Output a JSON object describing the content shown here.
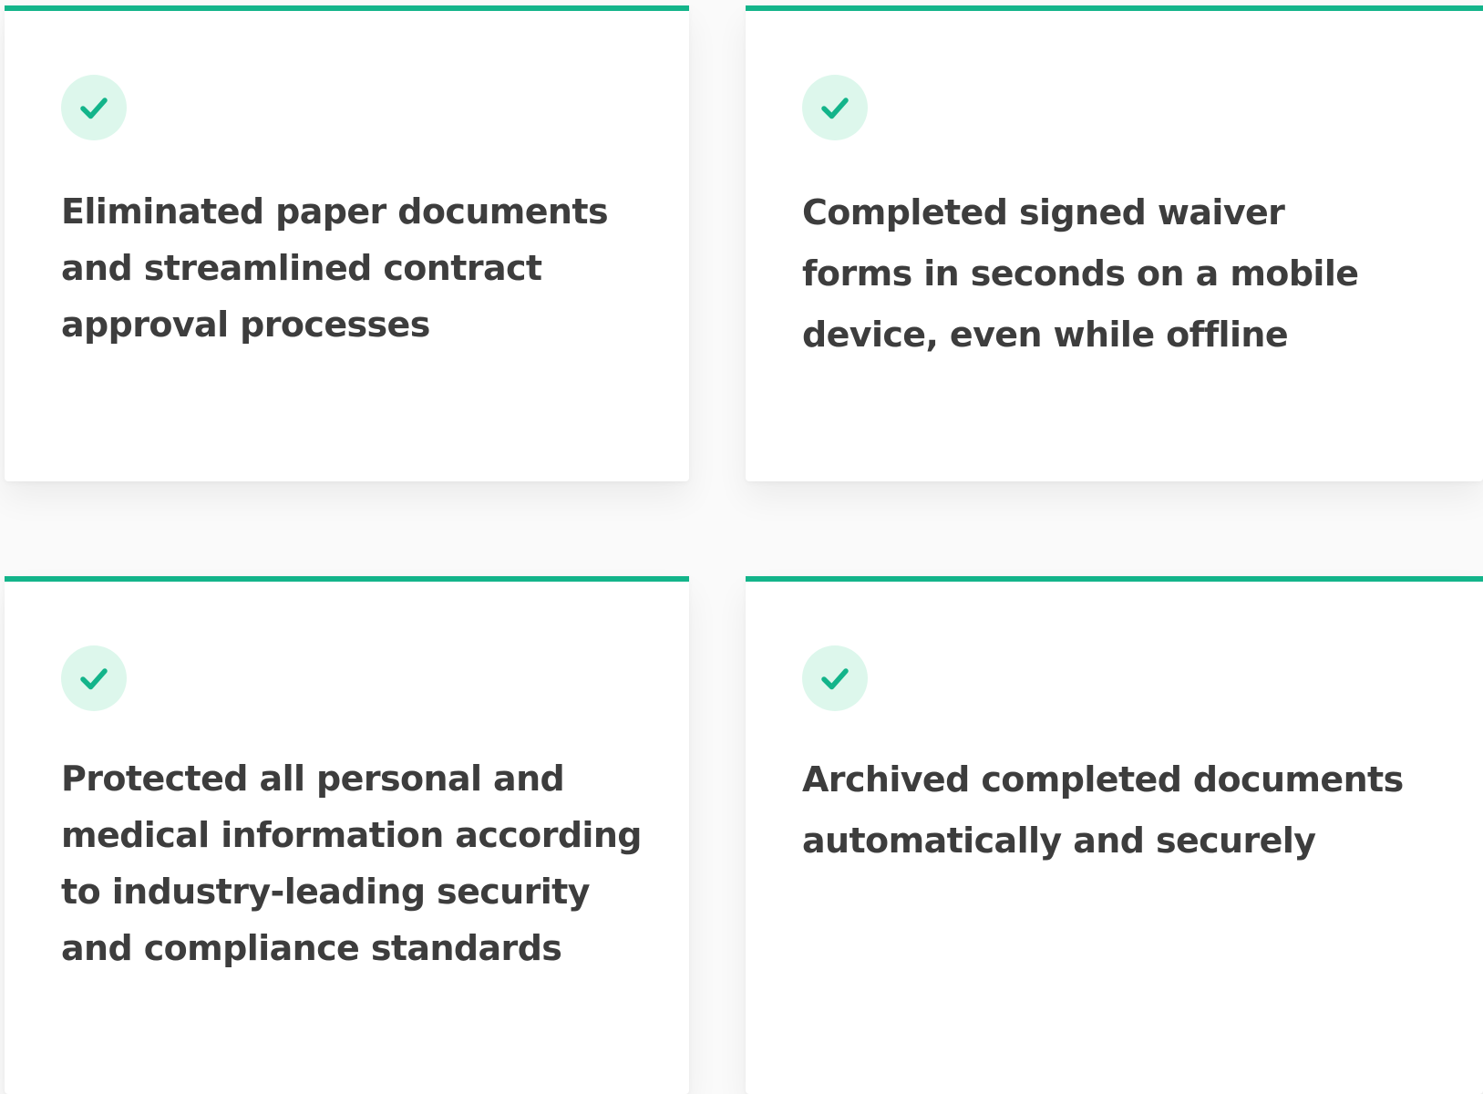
{
  "colors": {
    "accent": "#13b48a",
    "check_background": "#ddf7ec",
    "text": "#3d3d3d",
    "card_background": "#ffffff",
    "page_background": "#fafafa"
  },
  "cards": [
    {
      "icon": "check-icon",
      "text": "Eliminated paper documents and streamlined contract approval processes"
    },
    {
      "icon": "check-icon",
      "text": "Completed signed waiver forms in seconds on a mobile device, even while offline"
    },
    {
      "icon": "check-icon",
      "text": "Protected all personal and medical information according to industry-leading security and compliance standards"
    },
    {
      "icon": "check-icon",
      "text": "Archived completed documents automatically and securely"
    }
  ]
}
